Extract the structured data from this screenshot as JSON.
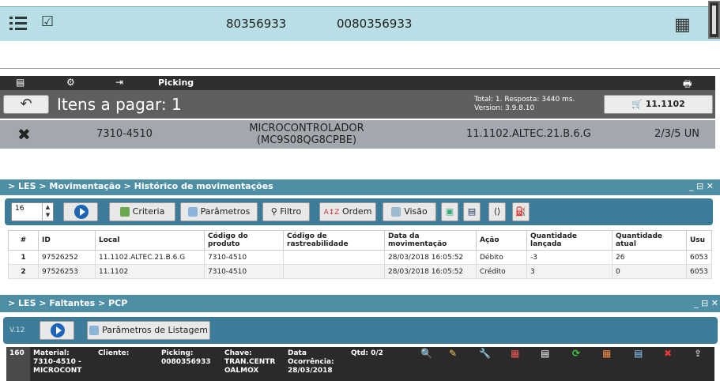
{
  "top_panel": {
    "number_a": "80356933",
    "number_b": "0080356933"
  },
  "picking_panel": {
    "tab_label": "Picking",
    "title": "Itens a pagar: 1",
    "info_line1": "Total: 1. Resposta: 3440 ms.",
    "info_line2": "Version: 3.9.8.10",
    "location_button": "11.1102",
    "item": {
      "code": "7310-4510",
      "description_line1": "MICROCONTROLADOR",
      "description_line2": "(MC9S08QG8CPBE)",
      "location": "11.1102.ALTEC.21.B.6.G",
      "quantity": "2/3/5 UN"
    }
  },
  "history_panel": {
    "breadcrumb": "> LES > Movimentação > Histórico de movimentações",
    "window_controls": "_ ⊟ ✕",
    "page_size": "16",
    "buttons": {
      "criteria": "Criteria",
      "parameters": "Parâmetros",
      "filter": "Filtro",
      "order": "Ordem",
      "view": "Visão"
    },
    "columns": [
      "#",
      "ID",
      "Local",
      "Código do produto",
      "Código de rastreabilidade",
      "Data da movimentação",
      "Ação",
      "Quantidade lançada",
      "Quantidade atual",
      "Usu"
    ],
    "rows": [
      [
        "1",
        "97526252",
        "11.1102.ALTEC.21.B.6.G",
        "7310-4510",
        "",
        "28/03/2018 16:05:52",
        "Débito",
        "-3",
        "26",
        "6053"
      ],
      [
        "2",
        "97526253",
        "11.1102",
        "7310-4510",
        "",
        "28/03/2018 16:05:52",
        "Crédito",
        "3",
        "0",
        "6053"
      ]
    ]
  },
  "faltantes_panel": {
    "breadcrumb": "> LES > Faltantes > PCP",
    "window_controls": "_ ⊟ ✕",
    "version": "V.12",
    "list_params_button": "Parâmetros de Listagem",
    "record": {
      "count": "160",
      "material_label": "Material:",
      "material_value1": "7310-4510 -",
      "material_value2": "MICROCONT",
      "cliente_label": "Cliente:",
      "picking_label": "Picking:",
      "picking_value": "0080356933",
      "chave_label": "Chave:",
      "chave_value1": "TRAN.CENTR",
      "chave_value2": "OALMOX",
      "data_label": "Data",
      "data_label2": "Ocorrência:",
      "data_value": "28/03/2018",
      "qtd": "Qtd: 0/2"
    }
  },
  "colors": {
    "teal_header": "#4f8fa6",
    "teal_toolbar": "#3c7c98",
    "light_cyan": "#b8dfe6",
    "dark_gray": "#2f2f2f"
  }
}
